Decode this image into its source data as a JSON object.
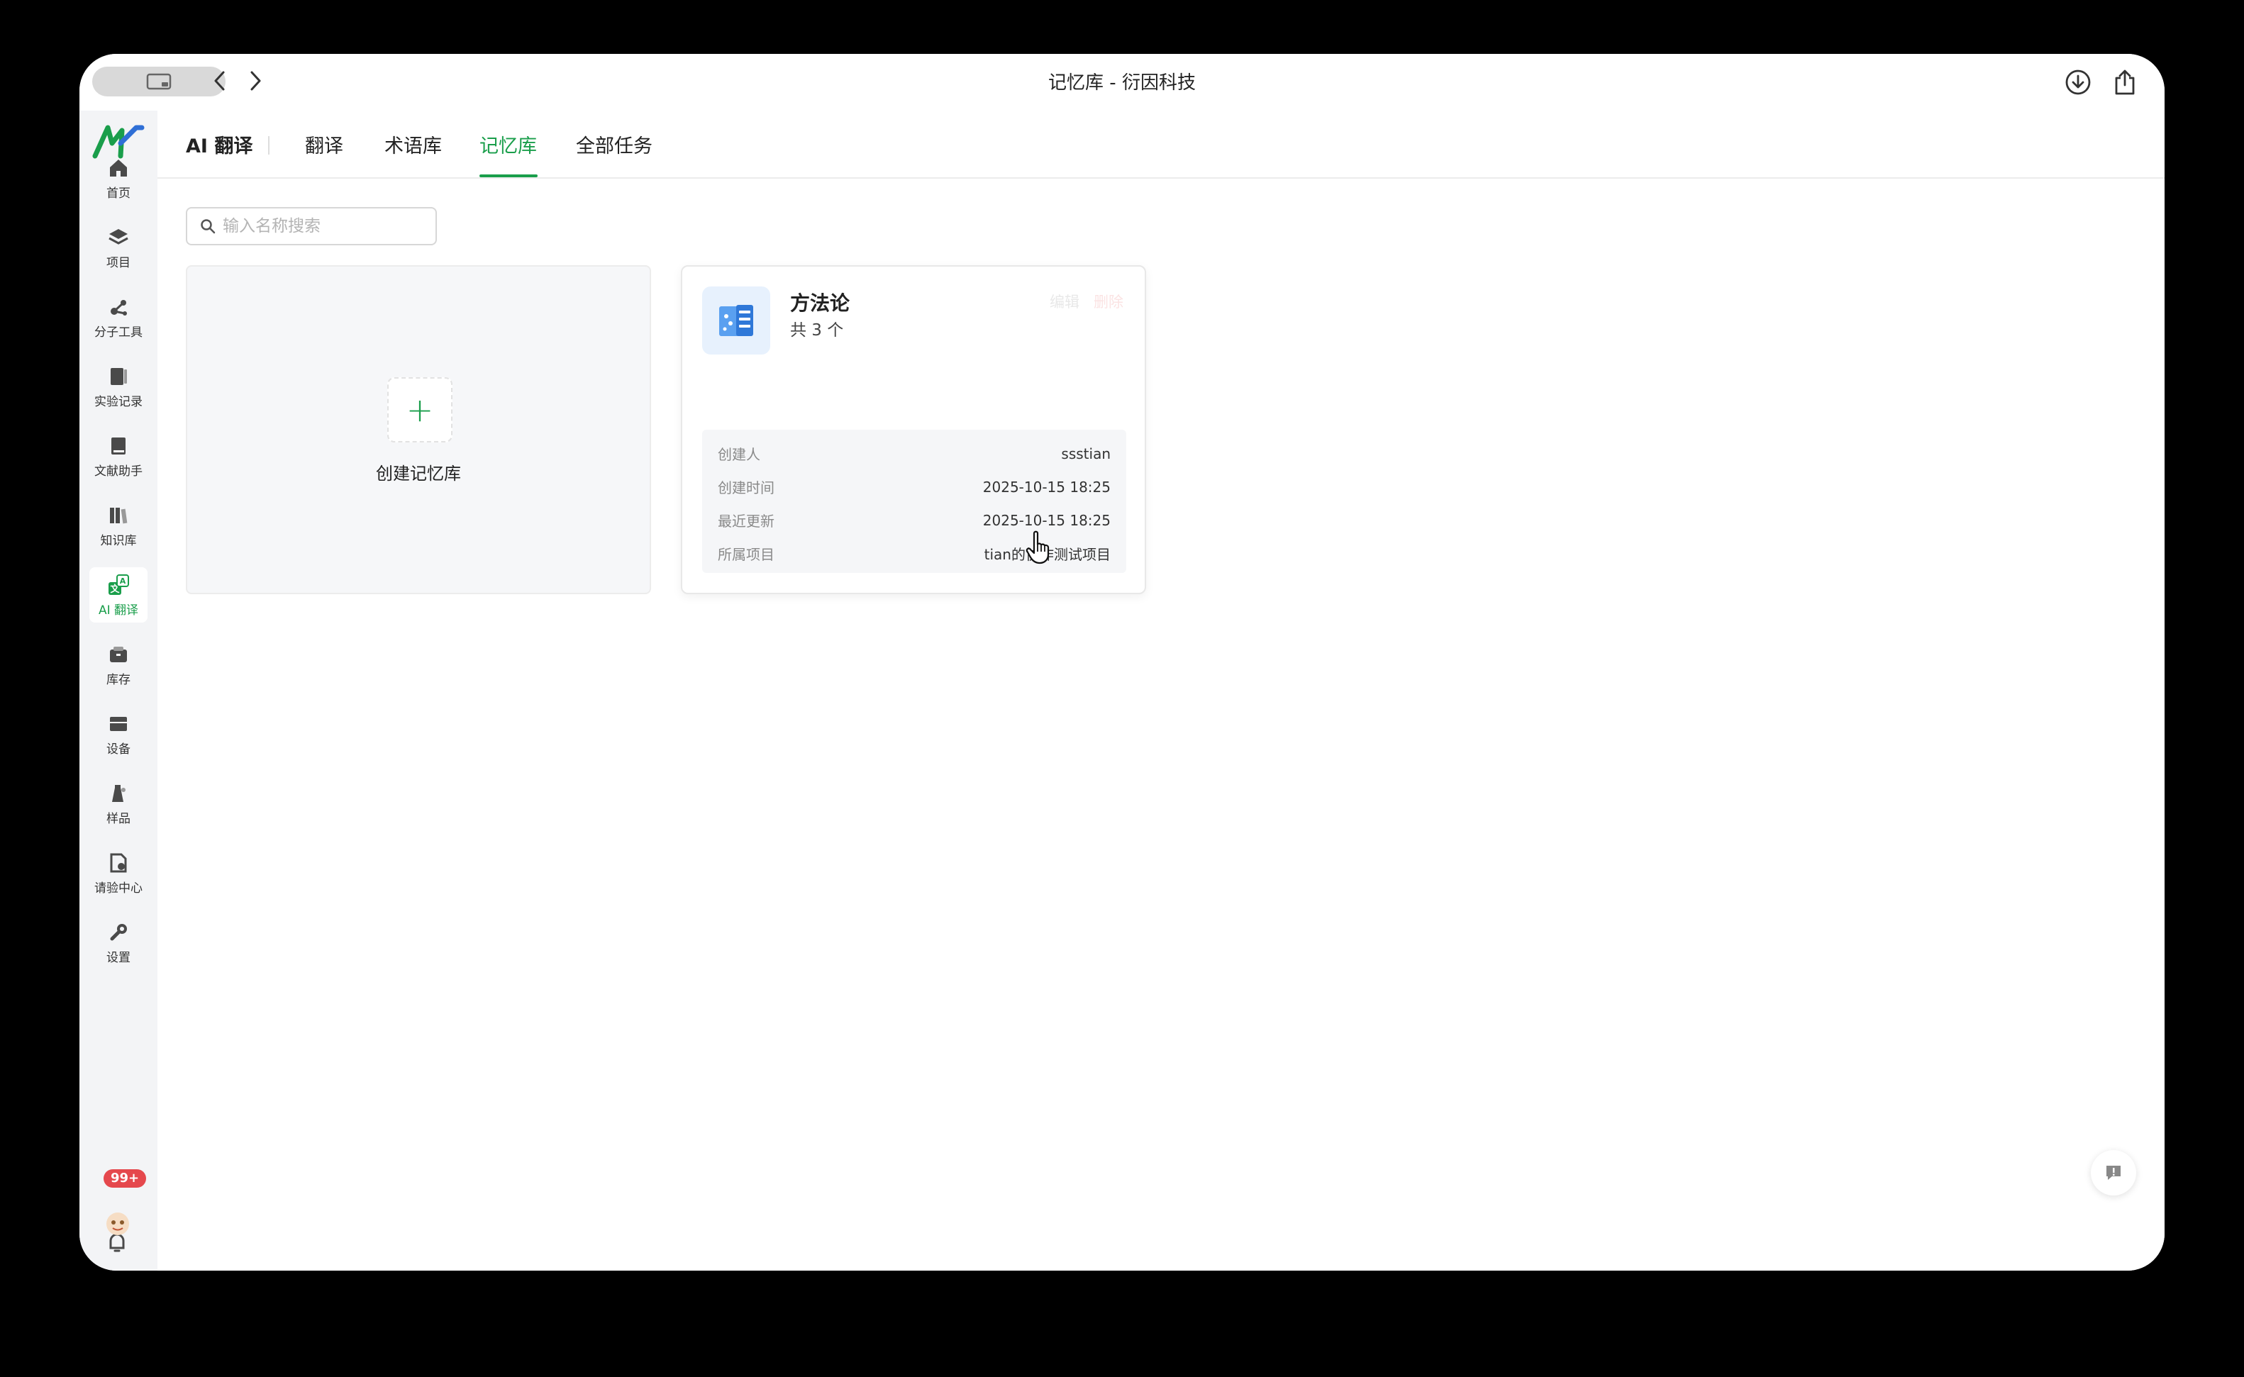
{
  "window": {
    "title": "记忆库 - 衍因科技"
  },
  "rail": {
    "items": [
      {
        "label": "首页",
        "icon": "home-icon"
      },
      {
        "label": "项目",
        "icon": "layers-icon"
      },
      {
        "label": "分子工具",
        "icon": "molecule-icon"
      },
      {
        "label": "实验记录",
        "icon": "notebook-icon"
      },
      {
        "label": "文献助手",
        "icon": "book-icon"
      },
      {
        "label": "知识库",
        "icon": "library-icon"
      },
      {
        "label": "AI 翻译",
        "icon": "translate-icon",
        "active": true
      },
      {
        "label": "库存",
        "icon": "inventory-icon"
      },
      {
        "label": "设备",
        "icon": "device-icon"
      },
      {
        "label": "样品",
        "icon": "sample-icon"
      },
      {
        "label": "请验中心",
        "icon": "inspection-icon"
      },
      {
        "label": "设置",
        "icon": "settings-icon"
      }
    ],
    "notification_badge": "99+"
  },
  "tabs": {
    "section": "AI 翻译",
    "items": [
      "翻译",
      "术语库",
      "记忆库",
      "全部任务"
    ],
    "active": "记忆库"
  },
  "search": {
    "placeholder": "输入名称搜索",
    "value": ""
  },
  "create_card": {
    "label": "创建记忆库",
    "plus": "+"
  },
  "memory_card": {
    "title": "方法论",
    "count": "共 3 个",
    "actions": {
      "edit": "编辑",
      "delete": "删除"
    },
    "meta": [
      {
        "key": "创建人",
        "value": "ssstian"
      },
      {
        "key": "创建时间",
        "value": "2025-10-15 18:25"
      },
      {
        "key": "最近更新",
        "value": "2025-10-15 18:25"
      },
      {
        "key": "所属项目",
        "value": "tian的协作测试项目"
      }
    ]
  },
  "colors": {
    "accent": "#1a9e4b",
    "badge": "#e5484d"
  }
}
